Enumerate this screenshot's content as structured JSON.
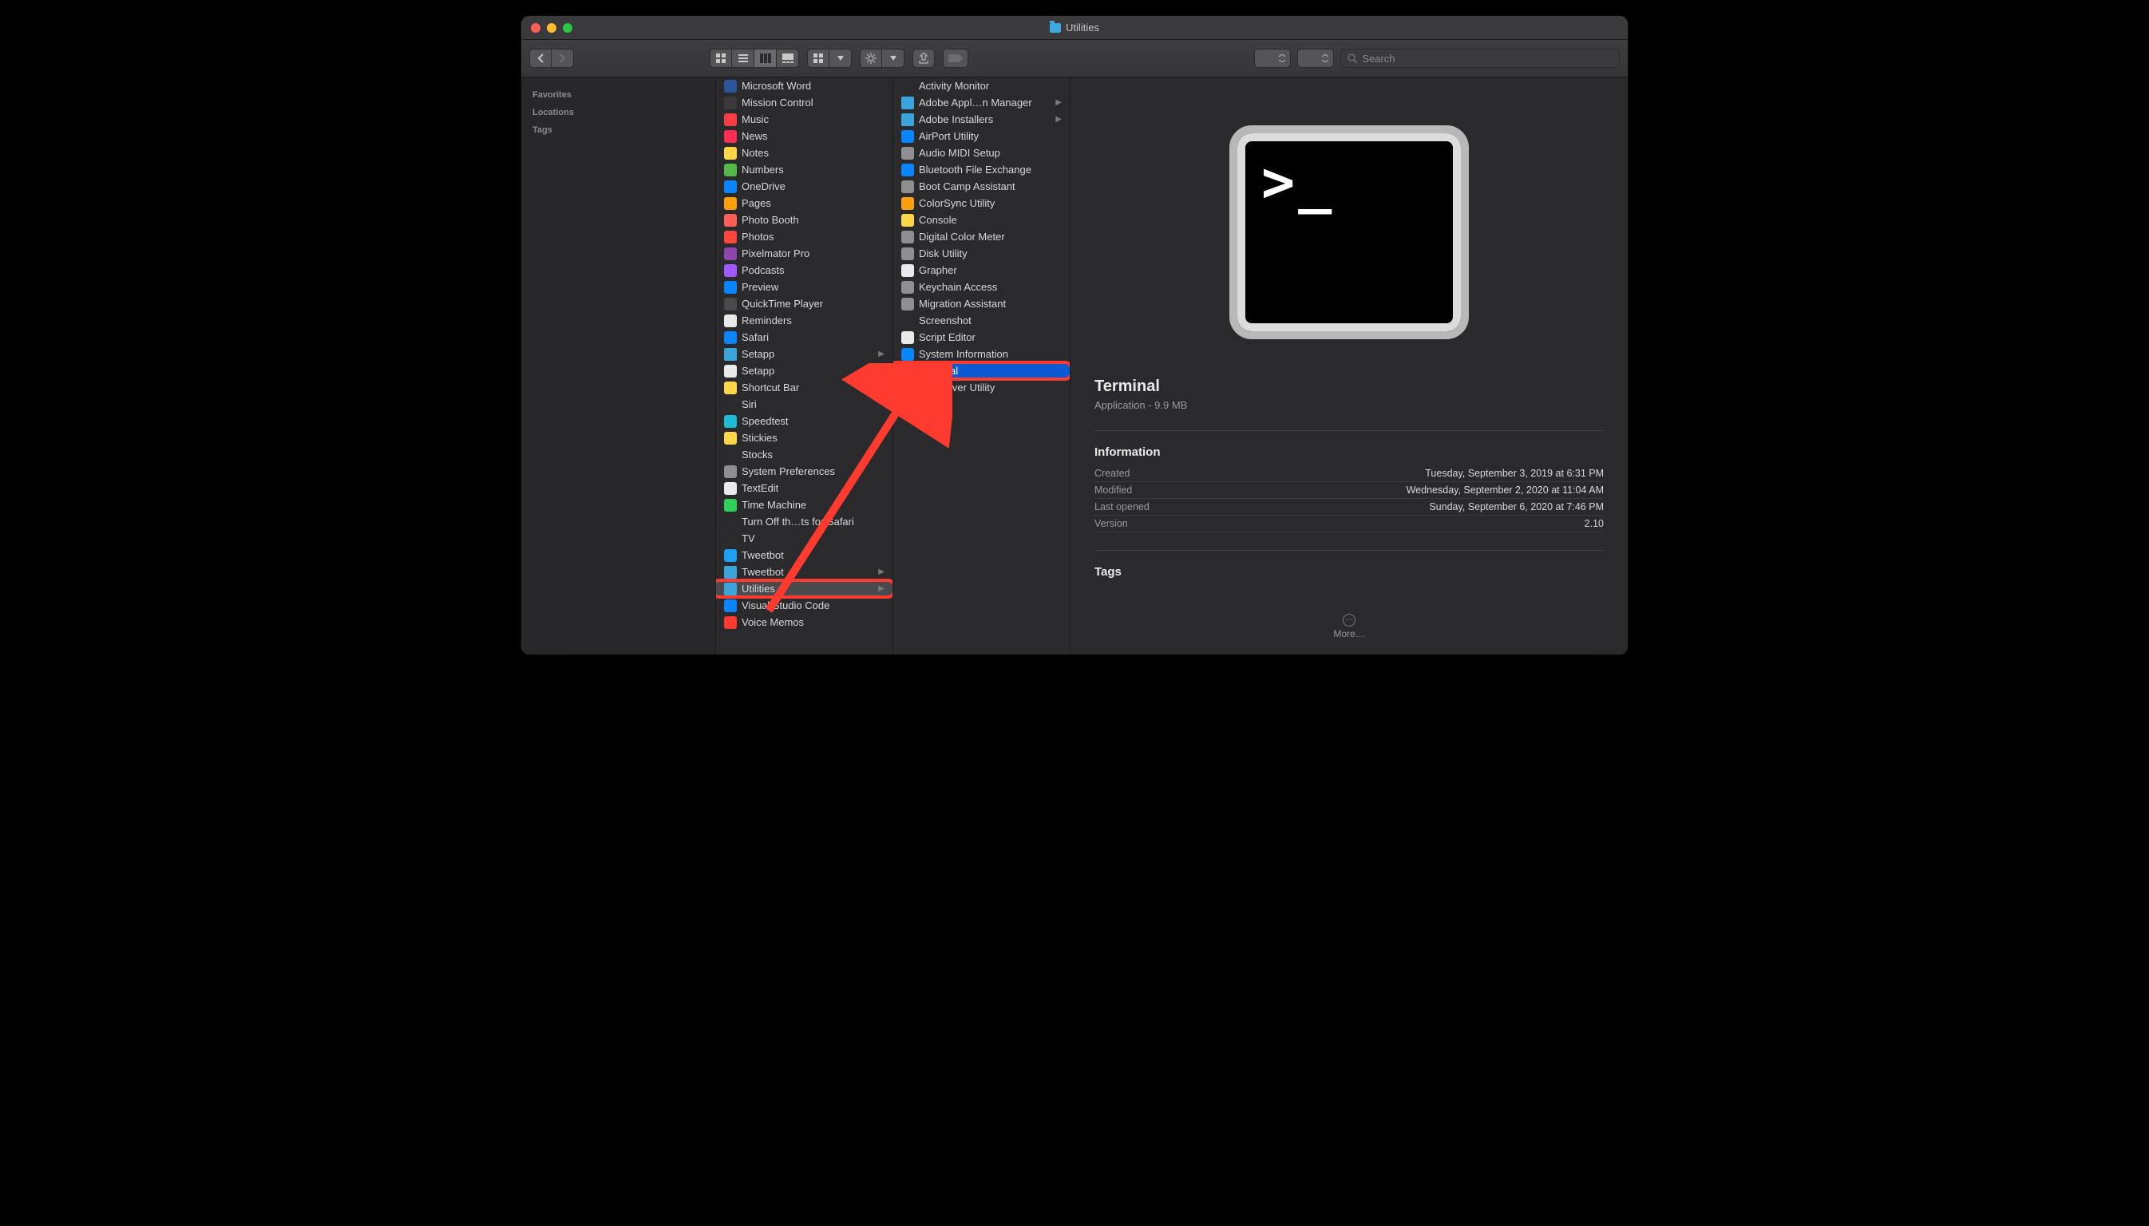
{
  "window": {
    "title": "Utilities"
  },
  "search": {
    "placeholder": "Search"
  },
  "sidebar": {
    "sections": [
      "Favorites",
      "Locations",
      "Tags"
    ]
  },
  "col1": [
    {
      "label": "Microsoft Word",
      "icon": "#2b579a"
    },
    {
      "label": "Mission Control",
      "icon": "#3a3a3c"
    },
    {
      "label": "Music",
      "icon": "#fc3c44"
    },
    {
      "label": "News",
      "icon": "#ff2d55"
    },
    {
      "label": "Notes",
      "icon": "#ffd54a"
    },
    {
      "label": "Numbers",
      "icon": "#55b948"
    },
    {
      "label": "OneDrive",
      "icon": "#0a84ff"
    },
    {
      "label": "Pages",
      "icon": "#ff9f0a"
    },
    {
      "label": "Photo Booth",
      "icon": "#ff5f57"
    },
    {
      "label": "Photos",
      "icon": "#ff453a"
    },
    {
      "label": "Pixelmator Pro",
      "icon": "#8e44ad"
    },
    {
      "label": "Podcasts",
      "icon": "#a259ff"
    },
    {
      "label": "Preview",
      "icon": "#0a84ff"
    },
    {
      "label": "QuickTime Player",
      "icon": "#4a4a4c"
    },
    {
      "label": "Reminders",
      "icon": "#eaeaea"
    },
    {
      "label": "Safari",
      "icon": "#0a84ff"
    },
    {
      "label": "Setapp",
      "icon": "#39a5dc",
      "folder": true,
      "hasChildren": true
    },
    {
      "label": "Setapp",
      "icon": "#eaeaea"
    },
    {
      "label": "Shortcut Bar",
      "icon": "#ffd54a"
    },
    {
      "label": "Siri",
      "icon": "#2b2b2d"
    },
    {
      "label": "Speedtest",
      "icon": "#1fbad6"
    },
    {
      "label": "Stickies",
      "icon": "#ffd54a"
    },
    {
      "label": "Stocks",
      "icon": "#2b2b2d"
    },
    {
      "label": "System Preferences",
      "icon": "#8e8e93"
    },
    {
      "label": "TextEdit",
      "icon": "#eaeaea"
    },
    {
      "label": "Time Machine",
      "icon": "#30d158"
    },
    {
      "label": "Turn Off th…ts for Safari",
      "icon": "#2b2b2d"
    },
    {
      "label": "TV",
      "icon": "#2b2b2d"
    },
    {
      "label": "Tweetbot",
      "icon": "#1da1f2"
    },
    {
      "label": "Tweetbot",
      "icon": "#39a5dc",
      "folder": true,
      "hasChildren": true
    },
    {
      "label": "Utilities",
      "icon": "#39a5dc",
      "folder": true,
      "hasChildren": true,
      "selected": "gray",
      "callout": true
    },
    {
      "label": "Visual Studio Code",
      "icon": "#0a84ff"
    },
    {
      "label": "Voice Memos",
      "icon": "#ff3b30"
    }
  ],
  "col2": [
    {
      "label": "Activity Monitor",
      "icon": "#2b2b2d"
    },
    {
      "label": "Adobe Appl…n Manager",
      "icon": "#39a5dc",
      "folder": true,
      "hasChildren": true
    },
    {
      "label": "Adobe Installers",
      "icon": "#39a5dc",
      "folder": true,
      "hasChildren": true
    },
    {
      "label": "AirPort Utility",
      "icon": "#0a84ff"
    },
    {
      "label": "Audio MIDI Setup",
      "icon": "#8e8e93"
    },
    {
      "label": "Bluetooth File Exchange",
      "icon": "#0a84ff"
    },
    {
      "label": "Boot Camp Assistant",
      "icon": "#8e8e93"
    },
    {
      "label": "ColorSync Utility",
      "icon": "#ff9f0a"
    },
    {
      "label": "Console",
      "icon": "#ffd54a"
    },
    {
      "label": "Digital Color Meter",
      "icon": "#8e8e93"
    },
    {
      "label": "Disk Utility",
      "icon": "#8e8e93"
    },
    {
      "label": "Grapher",
      "icon": "#eaeaea"
    },
    {
      "label": "Keychain Access",
      "icon": "#8e8e93"
    },
    {
      "label": "Migration Assistant",
      "icon": "#8e8e93"
    },
    {
      "label": "Screenshot",
      "icon": "#2b2b2d"
    },
    {
      "label": "Script Editor",
      "icon": "#eaeaea"
    },
    {
      "label": "System Information",
      "icon": "#0a84ff"
    },
    {
      "label": "Terminal",
      "icon": "#2b2b2d",
      "selected": "blue",
      "callout": true
    },
    {
      "label": "VoiceOver Utility",
      "icon": "#8e8e93"
    }
  ],
  "preview": {
    "title": "Terminal",
    "subtitle": "Application - 9.9 MB",
    "section": "Information",
    "rows": [
      {
        "k": "Created",
        "v": "Tuesday, September 3, 2019 at 6:31 PM"
      },
      {
        "k": "Modified",
        "v": "Wednesday, September 2, 2020 at 11:04 AM"
      },
      {
        "k": "Last opened",
        "v": "Sunday, September 6, 2020 at 7:46 PM"
      },
      {
        "k": "Version",
        "v": "2.10"
      }
    ],
    "tags_label": "Tags",
    "more_label": "More…"
  }
}
